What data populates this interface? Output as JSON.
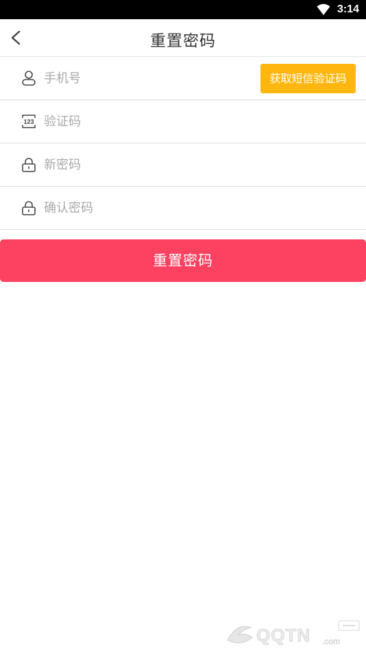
{
  "status_bar": {
    "time": "3:14",
    "wifi_icon": "wifi-icon"
  },
  "header": {
    "title": "重置密码",
    "back_icon": "chevron-left-icon"
  },
  "form": {
    "phone": {
      "icon": "user-icon",
      "placeholder": "手机号",
      "value": ""
    },
    "sms_button_label": "获取短信验证码",
    "code": {
      "icon": "numeric-123-icon",
      "placeholder": "验证码",
      "value": ""
    },
    "new_password": {
      "icon": "lock-icon",
      "placeholder": "新密码",
      "value": ""
    },
    "confirm_password": {
      "icon": "lock-icon",
      "placeholder": "确认密码",
      "value": ""
    }
  },
  "submit_label": "重置密码",
  "colors": {
    "accent": "#fd4160",
    "sms_button": "#ffb70f"
  }
}
